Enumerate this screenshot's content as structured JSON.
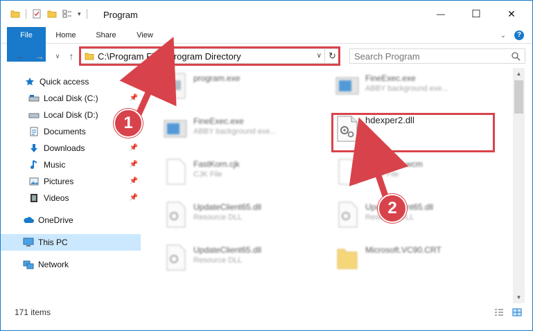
{
  "window": {
    "title": "Program",
    "minimize_glyph": "—",
    "maximize_glyph": "☐",
    "close_glyph": "✕"
  },
  "ribbon": {
    "tabs": [
      "File",
      "Home",
      "Share",
      "View"
    ],
    "help_label": "?"
  },
  "address": {
    "path": "C:\\Program Files\\Program Directory",
    "search_placeholder": "Search Program"
  },
  "nav": {
    "items": [
      {
        "label": "Quick access",
        "icon": "star-icon"
      },
      {
        "label": "Local Disk (C:)",
        "icon": "drive-icon",
        "pinned": true
      },
      {
        "label": "Local Disk (D:)",
        "icon": "drive-icon",
        "pinned": true
      },
      {
        "label": "Documents",
        "icon": "documents-icon",
        "pinned": true
      },
      {
        "label": "Downloads",
        "icon": "download-icon",
        "pinned": true
      },
      {
        "label": "Music",
        "icon": "music-icon",
        "pinned": true
      },
      {
        "label": "Pictures",
        "icon": "pictures-icon",
        "pinned": true
      },
      {
        "label": "Videos",
        "icon": "videos-icon",
        "pinned": true
      },
      {
        "label": "OneDrive",
        "icon": "cloud-icon"
      },
      {
        "label": "This PC",
        "icon": "computer-icon",
        "selected": true
      },
      {
        "label": "Network",
        "icon": "network-icon"
      }
    ]
  },
  "files": [
    {
      "name": "program.exe",
      "sub": ""
    },
    {
      "name": "FineExec.exe",
      "sub": "ABBY background exe..."
    },
    {
      "name": "FineExec.exe",
      "sub": "ABBY background exe..."
    },
    {
      "name": "hdexper2.dll",
      "sub": ""
    },
    {
      "name": "FastKorn.cjk",
      "sub": "CJK File"
    },
    {
      "name": "NeoWP16.wcm",
      "sub": "WCM File"
    },
    {
      "name": "UpdateClient65.dll",
      "sub": "Resource DLL"
    },
    {
      "name": "UpdateClient65.dll",
      "sub": "Resource DLL"
    },
    {
      "name": "UpdateClient65.dll",
      "sub": "Resource DLL"
    },
    {
      "name": "Microsoft.VC90.CRT",
      "sub": ""
    }
  ],
  "status": {
    "item_count": "171 items"
  },
  "annotations": {
    "step1": "1",
    "step2": "2"
  },
  "colors": {
    "accent": "#1979ca",
    "annotation_red": "#d8434b",
    "selected_bg": "#cce8ff"
  }
}
